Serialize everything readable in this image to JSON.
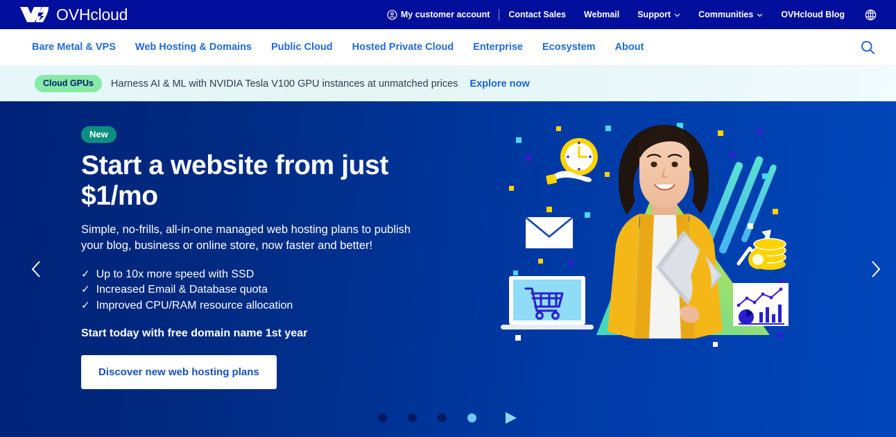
{
  "brand": {
    "name": "OVHcloud",
    "logo_icon": "ovhcloud-logo-icon",
    "primary_blue": "#000e9c",
    "accent_blue": "#1f6bd9",
    "hero_gradient_from": "#002379",
    "hero_gradient_to": "#0046bb"
  },
  "topbar": {
    "account": {
      "label": "My customer account",
      "icon": "user-circle-icon"
    },
    "links": [
      {
        "label": "Contact Sales",
        "has_caret": false
      },
      {
        "label": "Webmail",
        "has_caret": false
      },
      {
        "label": "Support",
        "has_caret": true
      },
      {
        "label": "Communities",
        "has_caret": true
      },
      {
        "label": "OVHcloud Blog",
        "has_caret": false
      }
    ],
    "language_icon": "globe-icon"
  },
  "mainnav": {
    "items": [
      {
        "label": "Bare Metal & VPS"
      },
      {
        "label": "Web Hosting & Domains"
      },
      {
        "label": "Public Cloud"
      },
      {
        "label": "Hosted Private Cloud"
      },
      {
        "label": "Enterprise"
      },
      {
        "label": "Ecosystem"
      },
      {
        "label": "About"
      }
    ],
    "search_icon": "search-icon"
  },
  "promo": {
    "badge": "Cloud GPUs",
    "badge_color": "#86eaa6",
    "text": "Harness AI & ML with NVIDIA Tesla V100 GPU instances at unmatched prices",
    "cta": "Explore now"
  },
  "hero": {
    "badge": "New",
    "badge_color": "#0b8f7e",
    "title": "Start a website from just $1/mo",
    "subtitle": "Simple, no-frills, all-in-one managed web hosting plans to publish your blog, business or online store, now faster and better!",
    "features": [
      {
        "check": "✓",
        "text": "Up to 10x more speed with SSD"
      },
      {
        "check": "✓",
        "text": "Increased Email & Database quota"
      },
      {
        "check": "✓",
        "text": "Improved CPU/RAM resource allocation"
      }
    ],
    "note": "Start today with free domain name 1st year",
    "cta": "Discover new web hosting plans",
    "prev_icon": "chevron-left-icon",
    "next_icon": "chevron-right-icon",
    "illustration": "woman-with-laptop-ecommerce-illustration"
  },
  "carousel": {
    "slides": 4,
    "active_index": 3,
    "dot_color": "#001b63",
    "dot_active_color": "#6fc7f5",
    "play_icon": "play-icon"
  }
}
